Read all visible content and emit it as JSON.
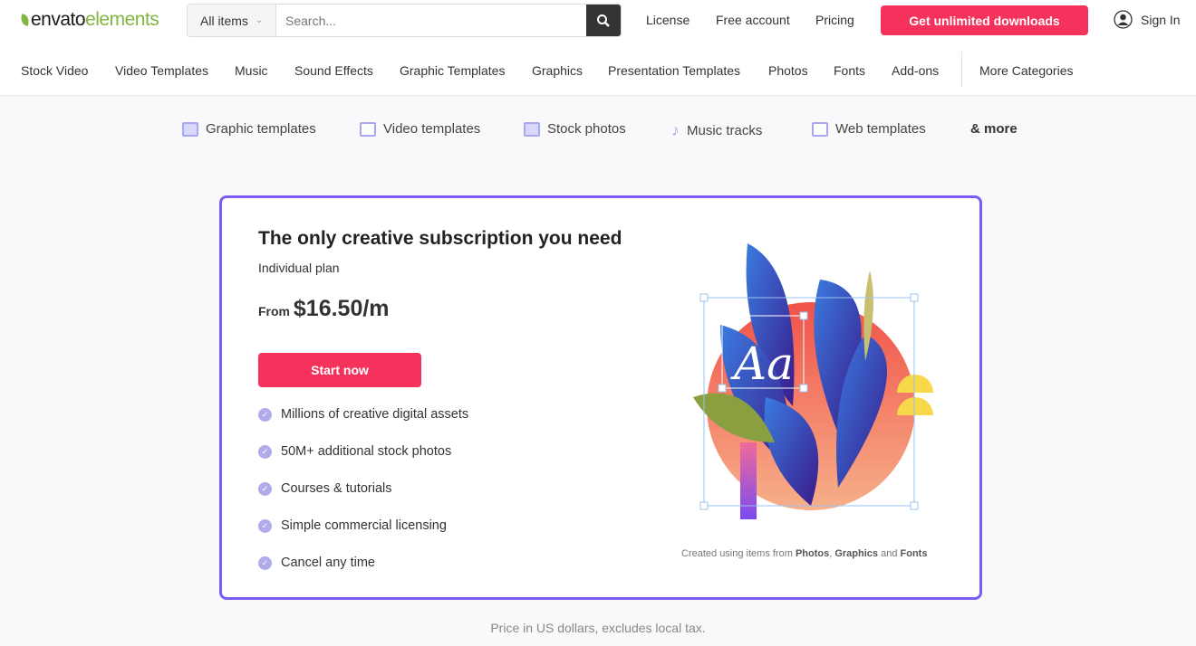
{
  "header": {
    "logo": {
      "brand": "envato",
      "product": "elements"
    },
    "search": {
      "category": "All items",
      "placeholder": "Search..."
    },
    "nav": [
      "License",
      "Free account",
      "Pricing"
    ],
    "cta": "Get unlimited downloads",
    "sign_in": "Sign In",
    "accent": "#f5325c"
  },
  "categories": [
    "Stock Video",
    "Video Templates",
    "Music",
    "Sound Effects",
    "Graphic Templates",
    "Graphics",
    "Presentation Templates",
    "Photos",
    "Fonts",
    "Add-ons",
    "More Categories"
  ],
  "strip": [
    {
      "label": "Graphic templates",
      "icon": "graphic-templates-icon"
    },
    {
      "label": "Video templates",
      "icon": "video-icon"
    },
    {
      "label": "Stock photos",
      "icon": "photo-icon"
    },
    {
      "label": "Music tracks",
      "icon": "music-note-icon"
    },
    {
      "label": "Web templates",
      "icon": "web-template-icon"
    },
    {
      "label": "& more"
    }
  ],
  "card": {
    "title": "The only creative subscription you need",
    "plan": "Individual plan",
    "price_prefix": "From",
    "price": "$16.50/m",
    "button": "Start now",
    "features": [
      "Millions of creative digital assets",
      "50M+ additional stock photos",
      "Courses & tutorials",
      "Simple commercial licensing",
      "Cancel any time"
    ],
    "credit": {
      "text1": "Created using items from ",
      "photos": "Photos",
      "sep": ", ",
      "graphics": "Graphics",
      "and": " and ",
      "fonts": "Fonts"
    },
    "border_color": "#7b5cf5"
  },
  "footnote": "Price in US dollars, excludes local tax."
}
